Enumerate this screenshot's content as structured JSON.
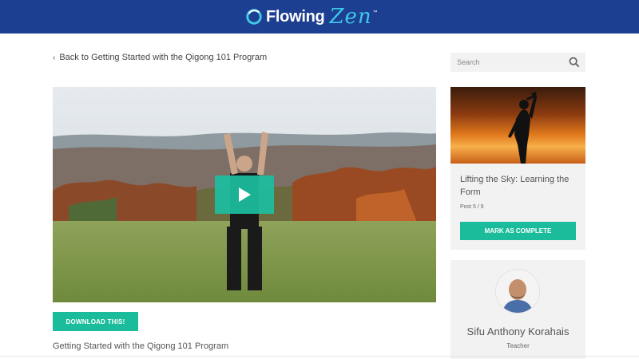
{
  "header": {
    "logo_word": "Flowing",
    "logo_zen": "Zen",
    "logo_tm": "™",
    "color": "#1d3f91"
  },
  "main": {
    "back_link": "Back to Getting Started with the Qigong 101 Program",
    "download_label": "DOWNLOAD THIS!",
    "bottom_title": "Getting Started with the Qigong 101 Program"
  },
  "sidebar": {
    "search_placeholder": "Search",
    "post": {
      "title": "Lifting the Sky: Learning the Form",
      "count": "Post 5 / 9",
      "mark_label": "MARK AS COMPLETE"
    },
    "author": {
      "name": "Sifu Anthony Korahais",
      "role": "Teacher"
    }
  },
  "colors": {
    "accent": "#1bbc9b",
    "header": "#1d3f91",
    "panel": "#f2f2f2"
  },
  "icons": [
    "chevron-left-icon",
    "search-icon",
    "play-icon",
    "logo-ring-icon"
  ]
}
